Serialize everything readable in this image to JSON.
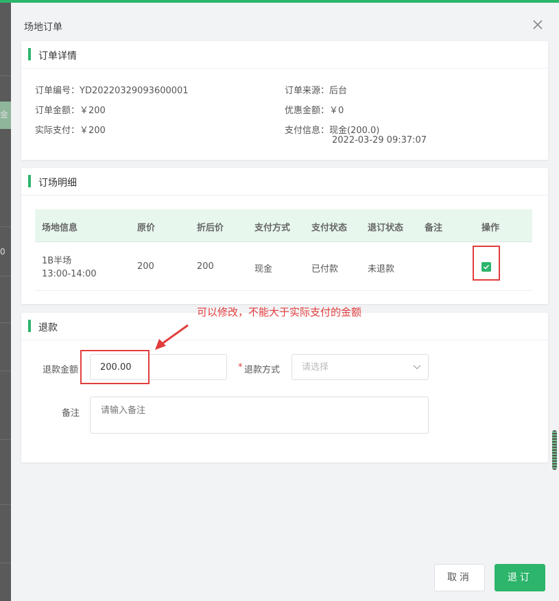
{
  "drawer": {
    "title": "场地订单"
  },
  "order_detail": {
    "section_title": "订单详情",
    "order_no_label": "订单编号：",
    "order_no": "YD20220329093600001",
    "source_label": "订单来源：",
    "source": "后台",
    "amount_label": "订单金额：",
    "amount": "￥200",
    "discount_label": "优惠金额：",
    "discount": "￥0",
    "paid_label": "实际支付：",
    "paid": "￥200",
    "pay_info_label": "支付信息：",
    "pay_info": "现金(200.0)",
    "pay_time": "2022-03-29 09:37:07"
  },
  "booking_detail": {
    "section_title": "订场明细",
    "columns": [
      "场地信息",
      "原价",
      "折后价",
      "支付方式",
      "支付状态",
      "退订状态",
      "备注",
      "操作"
    ],
    "rows": [
      {
        "venue": "1B半场",
        "time": "13:00-14:00",
        "original_price": "200",
        "discount_price": "200",
        "pay_method": "现金",
        "pay_status": "已付款",
        "refund_status": "未退款",
        "remark": "",
        "checked": true
      }
    ]
  },
  "refund": {
    "section_title": "退款",
    "amount_label": "退款金额",
    "amount_value": "200.00",
    "method_required": "*",
    "method_label": "退款方式",
    "method_placeholder": "请选择",
    "remark_label": "备注",
    "remark_placeholder": "请输入备注"
  },
  "annotation": {
    "text": "可以修改，不能大于实际支付的金额",
    "color": "#e23c3c"
  },
  "footer": {
    "cancel_label": "取消",
    "refund_label": "退订"
  },
  "colors": {
    "accent": "#2cb56b",
    "table_header_bg": "#e8f7ee",
    "annotation": "#e23c3c"
  },
  "backdrop": {
    "fragment_1": "金",
    "fragment_2": "0"
  }
}
